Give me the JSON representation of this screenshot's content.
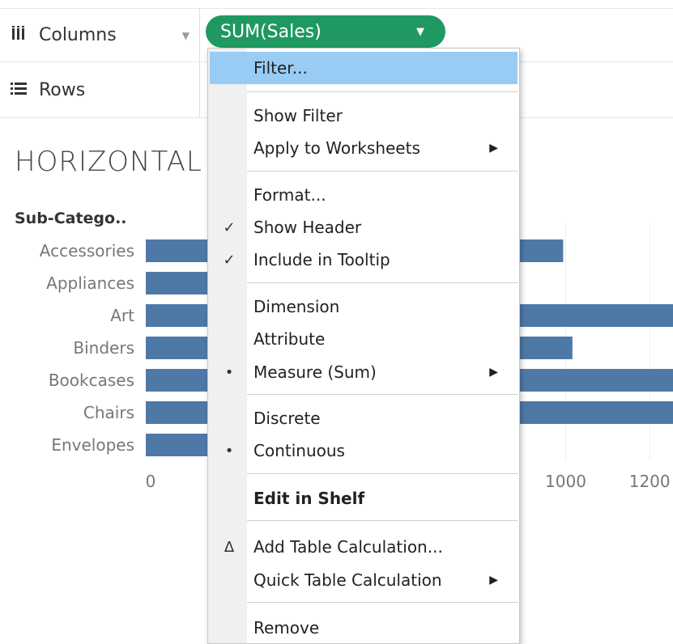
{
  "shelves": {
    "columns": {
      "icon": "columns-icon",
      "label": "Columns"
    },
    "rows": {
      "icon": "rows-icon",
      "label": "Rows"
    }
  },
  "pill": {
    "label": "SUM(Sales)",
    "arrow": "▼"
  },
  "sheet_title": "HORIZONTAL",
  "chart_data": {
    "type": "bar",
    "orientation": "horizontal",
    "ylabel": "Sub-Catego..",
    "categories": [
      "Accessories",
      "Appliances",
      "Art",
      "Binders",
      "Bookcases",
      "Chairs",
      "Envelopes"
    ],
    "values": [
      994,
      450,
      1300,
      1016,
      1300,
      1300,
      400
    ],
    "xlim": [
      0,
      1270
    ],
    "x_ticks": [
      "0",
      "1000",
      "1200"
    ],
    "x_tick_values": [
      0,
      1000,
      1200
    ],
    "bar_color": "#4e79a7",
    "grid": true
  },
  "context_menu": {
    "items": [
      {
        "label": "Filter...",
        "highlighted": true
      },
      {
        "label": "Show Filter"
      },
      {
        "label": "Apply to Worksheets",
        "submenu": true
      },
      {
        "label": "Format..."
      },
      {
        "label": "Show Header",
        "mark": "✓"
      },
      {
        "label": "Include in Tooltip",
        "mark": "✓"
      },
      {
        "label": "Dimension"
      },
      {
        "label": "Attribute"
      },
      {
        "label": "Measure (Sum)",
        "mark": "•",
        "submenu": true
      },
      {
        "label": "Discrete"
      },
      {
        "label": "Continuous",
        "mark": "•"
      },
      {
        "label": "Edit in Shelf",
        "bold": true
      },
      {
        "label": "Add Table Calculation...",
        "mark": "Δ"
      },
      {
        "label": "Quick Table Calculation",
        "submenu": true
      },
      {
        "label": "Remove"
      }
    ]
  },
  "colors": {
    "pill": "#1f9961",
    "highlight": "#99ccf5",
    "bar": "#4e79a7"
  }
}
